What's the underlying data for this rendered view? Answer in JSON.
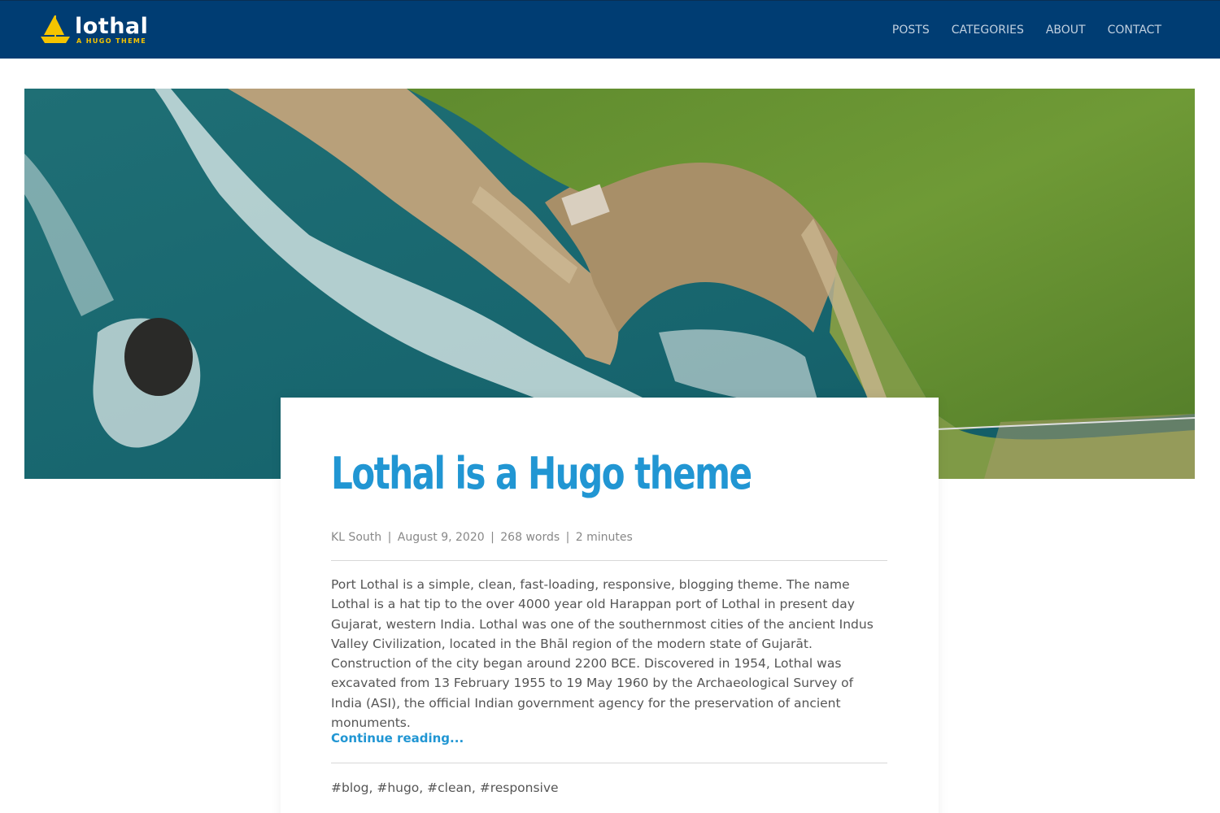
{
  "site": {
    "name": "lothal",
    "tagline": "A HUGO THEME",
    "colors": {
      "navbar": "#003d73",
      "accent": "#2196d3",
      "logo_yellow": "#f5c400"
    }
  },
  "nav": {
    "items": [
      {
        "label": "POSTS"
      },
      {
        "label": "CATEGORIES"
      },
      {
        "label": "ABOUT"
      },
      {
        "label": "CONTACT"
      }
    ]
  },
  "hero": {
    "icon": "aerial-coastline-photo"
  },
  "post": {
    "title": "Lothal is a Hugo theme",
    "author": "KL South",
    "date": "August 9, 2020",
    "word_count": "268 words",
    "reading_time": "2 minutes",
    "excerpt": "Port Lothal is a simple, clean, fast-loading, responsive, blogging theme. The name Lothal is a hat tip to the over 4000 year old Harappan port of Lothal in present day Gujarat, western India. Lothal was one of the southernmost cities of the ancient Indus Valley Civilization, located in the Bhāl region of the modern state of Gujarāt. Construction of the city began around 2200 BCE. Discovered in 1954, Lothal was excavated from 13 February 1955 to 19 May 1960 by the Archaeological Survey of India (ASI), the official Indian government agency for the preservation of ancient monuments.",
    "continue_label": "Continue reading...",
    "tags": [
      "#blog",
      "#hugo",
      "#clean",
      "#responsive"
    ]
  }
}
